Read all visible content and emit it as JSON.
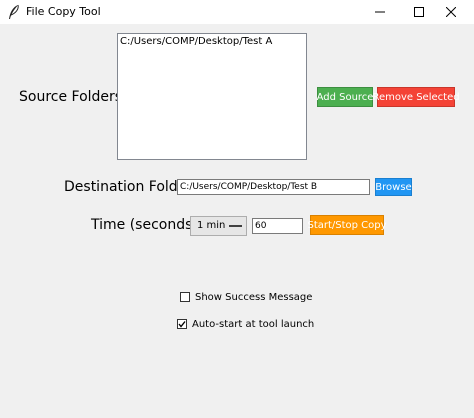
{
  "window": {
    "title": "File Copy Tool",
    "icon": "feather-icon",
    "controls": [
      "minimize-icon",
      "maximize-icon",
      "close-icon"
    ]
  },
  "source": {
    "label": "Source Folders:",
    "items": [
      "C:/Users/COMP/Desktop/Test A"
    ],
    "add_label": "Add Source",
    "remove_label": "Remove Selected"
  },
  "destination": {
    "label": "Destination Folder:",
    "value": "C:/Users/COMP/Desktop/Test B",
    "browse_label": "Browse"
  },
  "time": {
    "label": "Time (seconds):",
    "interval_option": "1 min",
    "seconds_value": "60",
    "startstop_label": "Start/Stop Copy"
  },
  "options": {
    "show_success": {
      "label": "Show Success Message",
      "checked": false
    },
    "auto_start": {
      "label": "Auto-start at tool launch",
      "checked": true
    }
  },
  "colors": {
    "add": "#4caf50",
    "remove": "#f44336",
    "browse": "#2196f3",
    "startstop": "#ff9800"
  }
}
